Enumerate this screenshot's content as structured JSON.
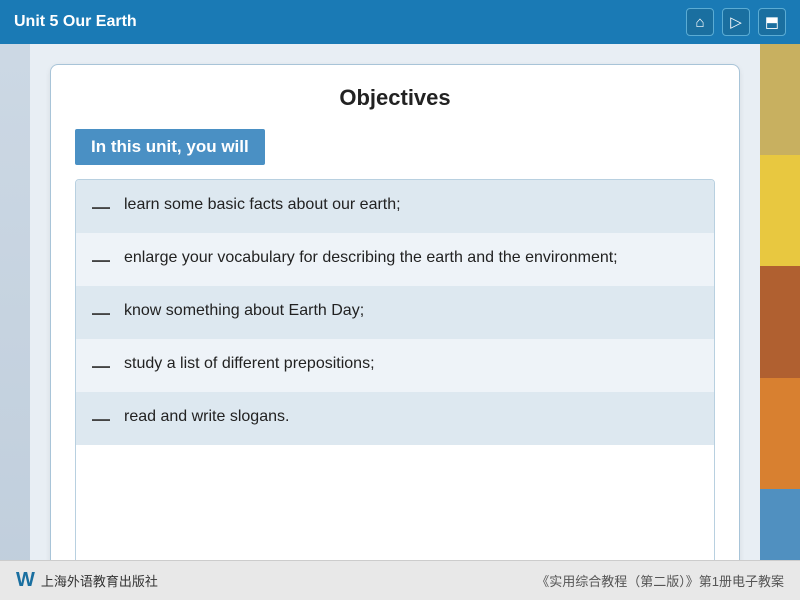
{
  "header": {
    "title": "Unit 5 Our Earth",
    "icons": [
      "home",
      "forward",
      "share"
    ]
  },
  "card": {
    "title": "Objectives",
    "banner": "In this unit, you will",
    "objectives": [
      "learn some basic facts about our earth;",
      "enlarge your vocabulary for describing the earth and the environment;",
      "know something about Earth Day;",
      "study a list of different prepositions;",
      "read and write slogans."
    ],
    "dash": "—"
  },
  "footer": {
    "publisher_icon": "W",
    "publisher_name": "上海外语教育出版社",
    "book_info": "《实用综合教程（第二版）》第1册电子教案"
  }
}
